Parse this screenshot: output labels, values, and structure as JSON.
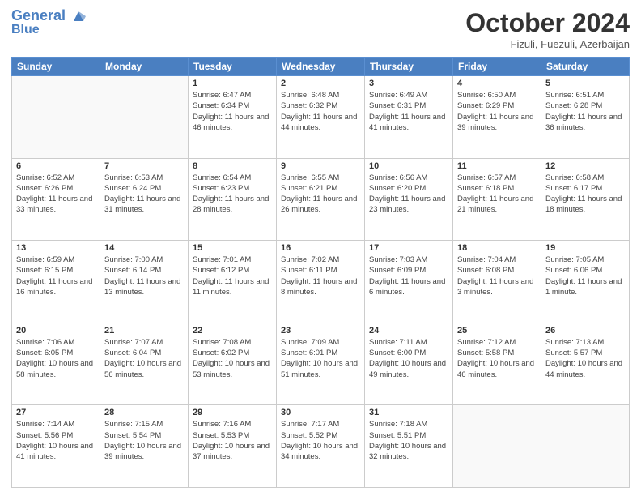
{
  "header": {
    "logo_line1": "General",
    "logo_line2": "Blue",
    "month": "October 2024",
    "location": "Fizuli, Fuezuli, Azerbaijan"
  },
  "columns": [
    "Sunday",
    "Monday",
    "Tuesday",
    "Wednesday",
    "Thursday",
    "Friday",
    "Saturday"
  ],
  "weeks": [
    [
      {
        "day": "",
        "info": ""
      },
      {
        "day": "",
        "info": ""
      },
      {
        "day": "1",
        "info": "Sunrise: 6:47 AM\nSunset: 6:34 PM\nDaylight: 11 hours and 46 minutes."
      },
      {
        "day": "2",
        "info": "Sunrise: 6:48 AM\nSunset: 6:32 PM\nDaylight: 11 hours and 44 minutes."
      },
      {
        "day": "3",
        "info": "Sunrise: 6:49 AM\nSunset: 6:31 PM\nDaylight: 11 hours and 41 minutes."
      },
      {
        "day": "4",
        "info": "Sunrise: 6:50 AM\nSunset: 6:29 PM\nDaylight: 11 hours and 39 minutes."
      },
      {
        "day": "5",
        "info": "Sunrise: 6:51 AM\nSunset: 6:28 PM\nDaylight: 11 hours and 36 minutes."
      }
    ],
    [
      {
        "day": "6",
        "info": "Sunrise: 6:52 AM\nSunset: 6:26 PM\nDaylight: 11 hours and 33 minutes."
      },
      {
        "day": "7",
        "info": "Sunrise: 6:53 AM\nSunset: 6:24 PM\nDaylight: 11 hours and 31 minutes."
      },
      {
        "day": "8",
        "info": "Sunrise: 6:54 AM\nSunset: 6:23 PM\nDaylight: 11 hours and 28 minutes."
      },
      {
        "day": "9",
        "info": "Sunrise: 6:55 AM\nSunset: 6:21 PM\nDaylight: 11 hours and 26 minutes."
      },
      {
        "day": "10",
        "info": "Sunrise: 6:56 AM\nSunset: 6:20 PM\nDaylight: 11 hours and 23 minutes."
      },
      {
        "day": "11",
        "info": "Sunrise: 6:57 AM\nSunset: 6:18 PM\nDaylight: 11 hours and 21 minutes."
      },
      {
        "day": "12",
        "info": "Sunrise: 6:58 AM\nSunset: 6:17 PM\nDaylight: 11 hours and 18 minutes."
      }
    ],
    [
      {
        "day": "13",
        "info": "Sunrise: 6:59 AM\nSunset: 6:15 PM\nDaylight: 11 hours and 16 minutes."
      },
      {
        "day": "14",
        "info": "Sunrise: 7:00 AM\nSunset: 6:14 PM\nDaylight: 11 hours and 13 minutes."
      },
      {
        "day": "15",
        "info": "Sunrise: 7:01 AM\nSunset: 6:12 PM\nDaylight: 11 hours and 11 minutes."
      },
      {
        "day": "16",
        "info": "Sunrise: 7:02 AM\nSunset: 6:11 PM\nDaylight: 11 hours and 8 minutes."
      },
      {
        "day": "17",
        "info": "Sunrise: 7:03 AM\nSunset: 6:09 PM\nDaylight: 11 hours and 6 minutes."
      },
      {
        "day": "18",
        "info": "Sunrise: 7:04 AM\nSunset: 6:08 PM\nDaylight: 11 hours and 3 minutes."
      },
      {
        "day": "19",
        "info": "Sunrise: 7:05 AM\nSunset: 6:06 PM\nDaylight: 11 hours and 1 minute."
      }
    ],
    [
      {
        "day": "20",
        "info": "Sunrise: 7:06 AM\nSunset: 6:05 PM\nDaylight: 10 hours and 58 minutes."
      },
      {
        "day": "21",
        "info": "Sunrise: 7:07 AM\nSunset: 6:04 PM\nDaylight: 10 hours and 56 minutes."
      },
      {
        "day": "22",
        "info": "Sunrise: 7:08 AM\nSunset: 6:02 PM\nDaylight: 10 hours and 53 minutes."
      },
      {
        "day": "23",
        "info": "Sunrise: 7:09 AM\nSunset: 6:01 PM\nDaylight: 10 hours and 51 minutes."
      },
      {
        "day": "24",
        "info": "Sunrise: 7:11 AM\nSunset: 6:00 PM\nDaylight: 10 hours and 49 minutes."
      },
      {
        "day": "25",
        "info": "Sunrise: 7:12 AM\nSunset: 5:58 PM\nDaylight: 10 hours and 46 minutes."
      },
      {
        "day": "26",
        "info": "Sunrise: 7:13 AM\nSunset: 5:57 PM\nDaylight: 10 hours and 44 minutes."
      }
    ],
    [
      {
        "day": "27",
        "info": "Sunrise: 7:14 AM\nSunset: 5:56 PM\nDaylight: 10 hours and 41 minutes."
      },
      {
        "day": "28",
        "info": "Sunrise: 7:15 AM\nSunset: 5:54 PM\nDaylight: 10 hours and 39 minutes."
      },
      {
        "day": "29",
        "info": "Sunrise: 7:16 AM\nSunset: 5:53 PM\nDaylight: 10 hours and 37 minutes."
      },
      {
        "day": "30",
        "info": "Sunrise: 7:17 AM\nSunset: 5:52 PM\nDaylight: 10 hours and 34 minutes."
      },
      {
        "day": "31",
        "info": "Sunrise: 7:18 AM\nSunset: 5:51 PM\nDaylight: 10 hours and 32 minutes."
      },
      {
        "day": "",
        "info": ""
      },
      {
        "day": "",
        "info": ""
      }
    ]
  ]
}
